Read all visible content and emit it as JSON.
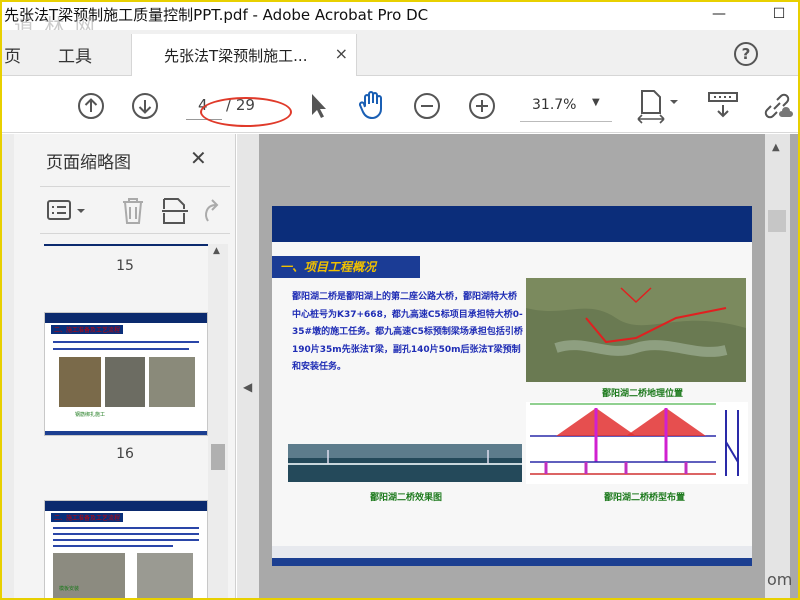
{
  "window": {
    "title": "先张法T梁预制施工质量控制PPT.pdf - Adobe Acrobat Pro DC",
    "minimize_glyph": "—",
    "maximize_glyph": "☐",
    "watermark": "道 林 网"
  },
  "tabs": {
    "home": "页",
    "tools": "工具",
    "document": "先张法T梁预制施工...",
    "close_glyph": "×",
    "help_glyph": "?"
  },
  "toolbar": {
    "current_page": "4",
    "total_pages": "/ 29",
    "zoom": "31.7%",
    "icons": [
      "up-arrow-icon",
      "down-arrow-icon",
      "select-pointer-icon",
      "hand-tool-icon",
      "zoom-out-icon",
      "zoom-in-icon",
      "page-fit-icon",
      "scroll-mode-icon",
      "link-icon"
    ],
    "accent_color": "#1a5fb4",
    "annotation_color": "#e03a2a"
  },
  "sidebar": {
    "title": "页面缩略图",
    "close_glyph": "✕",
    "icons": [
      "thumbnail-options-icon",
      "delete-page-icon",
      "extract-page-icon",
      "undo-icon"
    ],
    "pages": [
      {
        "number": "15",
        "slide_title": "二、施工准备及工艺流程",
        "caption": "钢筋绑扎施工"
      },
      {
        "number": "16",
        "slide_title": "二、施工准备及工艺流程",
        "caption": "模板安装"
      }
    ]
  },
  "slide": {
    "section_title": "一、项目工程概况",
    "paragraph": "鄱阳湖二桥是鄱阳湖上的第二座公路大桥，鄱阳湖特大桥中心桩号为K37+668，都九高速C5标项目承担特大桥0-35#墩的施工任务。都九高速C5标预制梁场承担包括引桥190片35m先张法T梁，副孔140片50m后张法T梁预制和安装任务。",
    "map_caption": "鄱阳湖二桥地理位置",
    "bridge_caption": "鄱阳湖二桥效果图",
    "layout_caption": "鄱阳湖二桥桥型布置"
  },
  "document_area": {
    "background": "#a9a9a9",
    "corner_text": "om"
  }
}
